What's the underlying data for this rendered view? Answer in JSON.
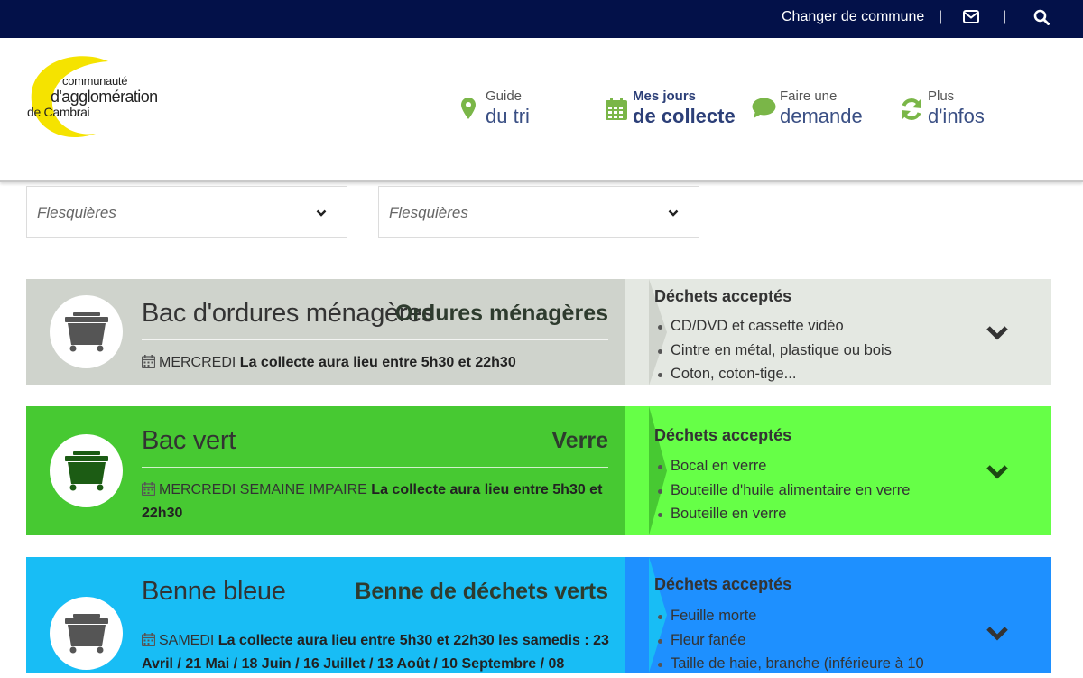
{
  "topbar": {
    "change_label": "Changer de commune",
    "separator": "|",
    "mail_icon": "envelope-icon",
    "search_icon": "search-icon"
  },
  "logo": {
    "line1": "communauté",
    "line2": "d'agglomération",
    "line3": "de Cambrai"
  },
  "nav": [
    {
      "small": "Guide",
      "big": "du tri",
      "icon": "map-marker-icon",
      "color": "#7ab648"
    },
    {
      "small": "Mes jours",
      "big": "de collecte",
      "icon": "calendar-icon",
      "color": "#7ab648",
      "active": true
    },
    {
      "small": "Faire une",
      "big": "demande",
      "icon": "chat-bubble-icon",
      "color": "#7ab648"
    },
    {
      "small": "Plus",
      "big": "d'infos",
      "icon": "refresh-icon",
      "color": "#7ab648"
    }
  ],
  "selects": [
    {
      "value": "Flesquières"
    },
    {
      "value": "Flesquières"
    }
  ],
  "cards": [
    {
      "type": "Bac d'ordures ménagères",
      "waste": "Ordures ménagères",
      "day": "MERCREDI",
      "schedule": "La collecte aura lieu entre 5h30 et 22h30",
      "accepted_title": "Déchets acceptés",
      "items": [
        "CD/DVD et cassette vidéo",
        "Cintre en métal, plastique ou bois",
        "Coton, coton-tige..."
      ],
      "colors": {
        "left": "#cfd3cc",
        "right": "#e4e8e2",
        "bin": "#555555"
      }
    },
    {
      "type": "Bac vert",
      "waste": "Verre",
      "day": "MERCREDI SEMAINE IMPAIRE",
      "schedule": "La collecte aura lieu entre 5h30 et 22h30",
      "accepted_title": "Déchets acceptés",
      "items": [
        "Bocal en verre",
        "Bouteille d'huile alimentaire en verre",
        "Bouteille en verre"
      ],
      "colors": {
        "left": "#47c932",
        "right": "#66ff47",
        "bin": "#1c5c14"
      }
    },
    {
      "type": "Benne bleue",
      "waste": "Benne de déchets verts",
      "day": "SAMEDI",
      "schedule": "La collecte aura lieu entre 5h30 et 22h30 les samedis : 23 Avril / 21 Mai / 18 Juin / 16 Juillet / 13 Août / 10 Septembre / 08",
      "accepted_title": "Déchets acceptés",
      "items": [
        "Feuille morte",
        "Fleur fanée",
        "Taille de haie, branche (inférieure à 10"
      ],
      "colors": {
        "left": "#18bdf5",
        "right": "#1e90ff",
        "bin": "#555555"
      }
    }
  ]
}
